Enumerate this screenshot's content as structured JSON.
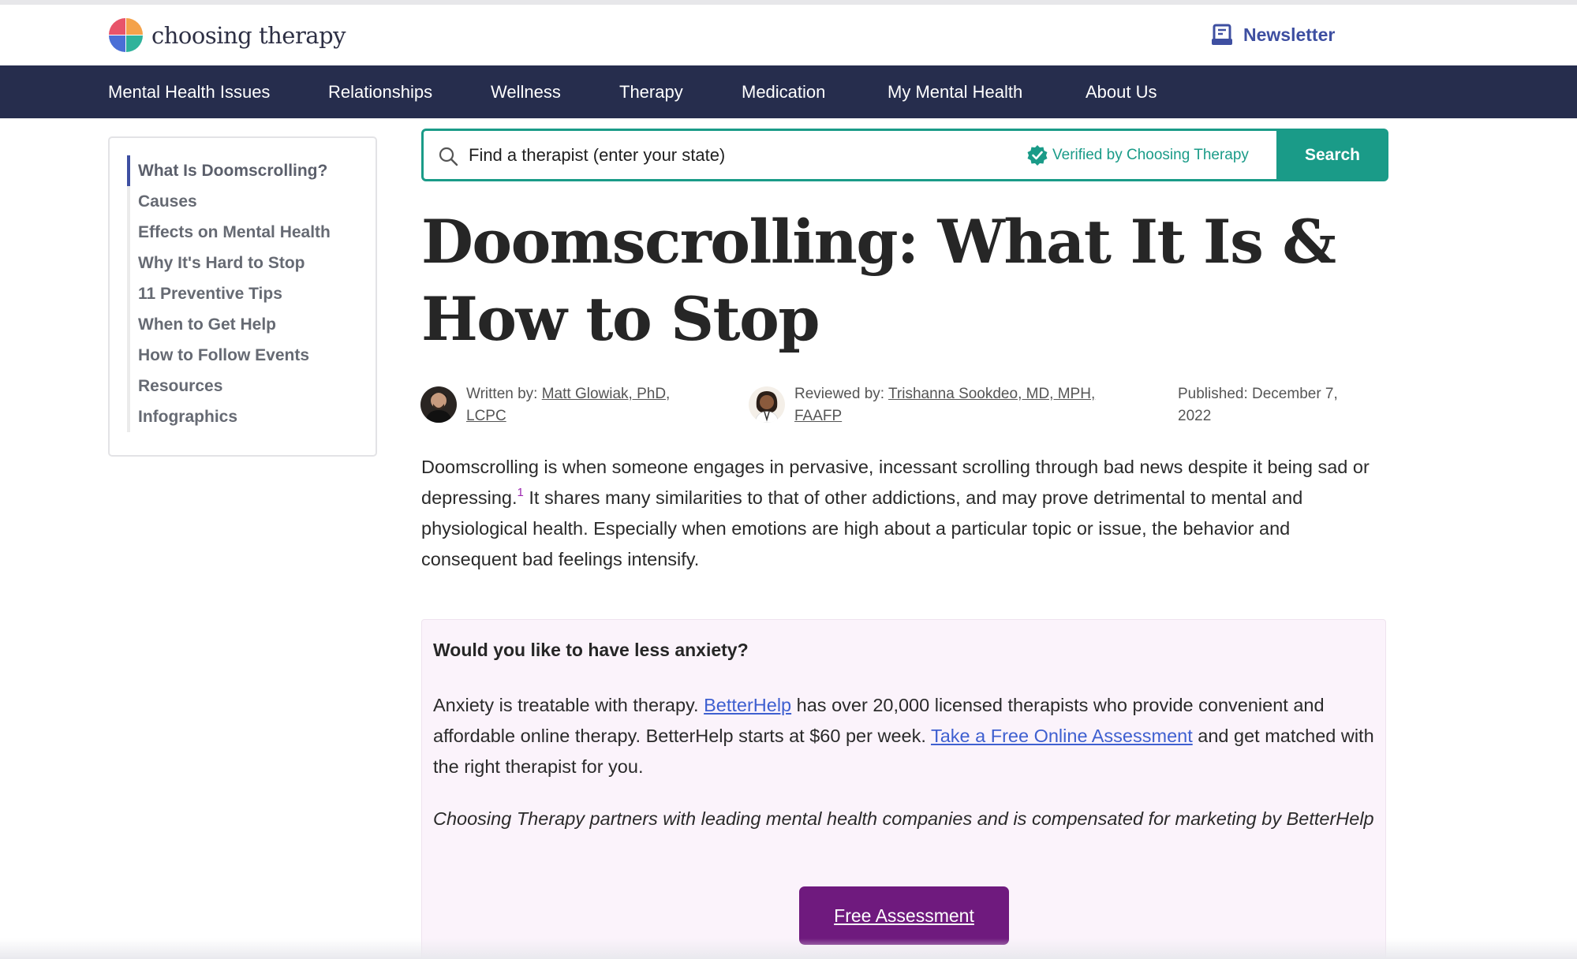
{
  "header": {
    "logo_text": "choosing therapy",
    "newsletter_label": "Newsletter",
    "icon_newsletter": "newsletter-icon"
  },
  "nav": {
    "items": [
      {
        "label": "Mental Health Issues"
      },
      {
        "label": "Relationships"
      },
      {
        "label": "Wellness"
      },
      {
        "label": "Therapy"
      },
      {
        "label": "Medication"
      },
      {
        "label": "My Mental Health"
      },
      {
        "label": "About Us"
      }
    ]
  },
  "toc": {
    "items": [
      {
        "label": "What Is Doomscrolling?",
        "active": true
      },
      {
        "label": "Causes"
      },
      {
        "label": "Effects on Mental Health"
      },
      {
        "label": "Why It's Hard to Stop"
      },
      {
        "label": "11 Preventive Tips"
      },
      {
        "label": "When to Get Help"
      },
      {
        "label": "How to Follow Events"
      },
      {
        "label": "Resources"
      },
      {
        "label": "Infographics"
      }
    ]
  },
  "search": {
    "placeholder": "Find a therapist (enter your state)",
    "value": "",
    "verified_label": "Verified by Choosing Therapy",
    "button_label": "Search"
  },
  "article": {
    "title_line1": "Doomscrolling: What It Is &",
    "title_line2": "How to Stop",
    "written_prefix": "Written by: ",
    "author_line1": "Matt Glowiak, PhD,",
    "author_line2": "LCPC",
    "reviewed_prefix": "Reviewed by: ",
    "reviewer_line1": "Trishanna Sookdeo, MD, MPH,",
    "reviewer_line2": "FAAFP",
    "published_line1": "Published: December 7,",
    "published_line2": "2022",
    "intro_part1": "Doomscrolling is when someone engages in pervasive, incessant scrolling through bad news despite it being sad or depressing.",
    "intro_ref": "1",
    "intro_part2": " It shares many similarities to that of other addictions, and may prove detrimental to mental and physiological health. Especially when emotions are high about a particular topic or issue, the behavior and consequent bad feelings intensify."
  },
  "promo": {
    "heading": "Would you like to have less anxiety?",
    "body_part1": "Anxiety is treatable with therapy. ",
    "betterhelp_link": "BetterHelp",
    "body_part2": " has over 20,000 licensed therapists who provide convenient and affordable online therapy. BetterHelp starts at $60 per week. ",
    "assessment_link": "Take a Free Online Assessment",
    "body_part3": " and get matched with the right therapist for you.",
    "disclosure": "Choosing Therapy partners with leading mental health companies and is compensated for marketing by BetterHelp",
    "button_label": "Free Assessment"
  },
  "colors": {
    "nav_bg": "#262d4d",
    "accent_teal": "#1a9b88",
    "brand_blue": "#3e4fa1",
    "promo_button": "#6f1a7e",
    "promo_bg": "#fbf3fb"
  }
}
